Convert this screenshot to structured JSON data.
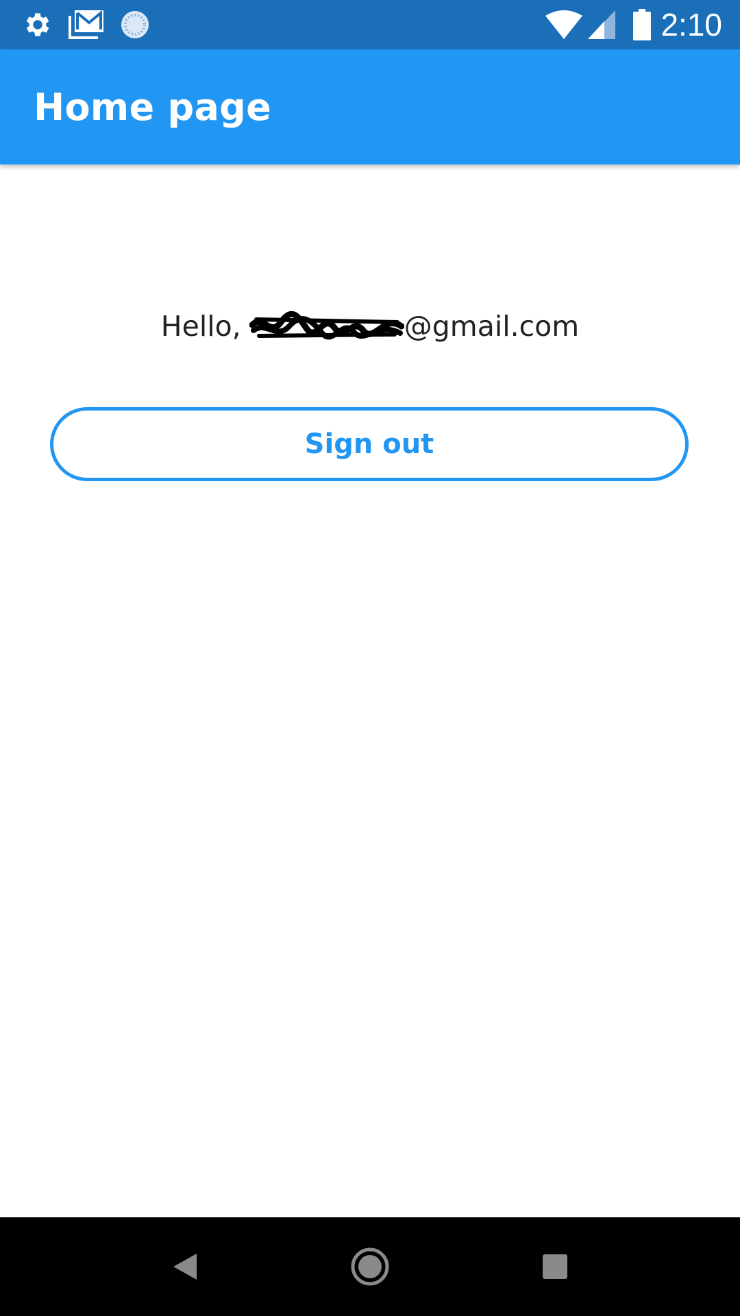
{
  "status_bar": {
    "time": "2:10",
    "left_icons": [
      "gear-icon",
      "gmail-icon",
      "sync-spinner-icon"
    ],
    "right_icons": [
      "wifi-icon",
      "cell-signal-icon",
      "battery-icon"
    ]
  },
  "app_bar": {
    "title": "Home page"
  },
  "main": {
    "greeting_prefix": "Hello,",
    "email_domain": "@gmail.com",
    "sign_out_label": "Sign out"
  },
  "nav_bar": {
    "buttons": [
      "back-icon",
      "home-icon",
      "recents-icon"
    ]
  },
  "colors": {
    "status_bar": "#1a6fb8",
    "app_bar": "#2196f3",
    "accent": "#2196f3",
    "text": "#222222",
    "nav_bar": "#000000"
  }
}
